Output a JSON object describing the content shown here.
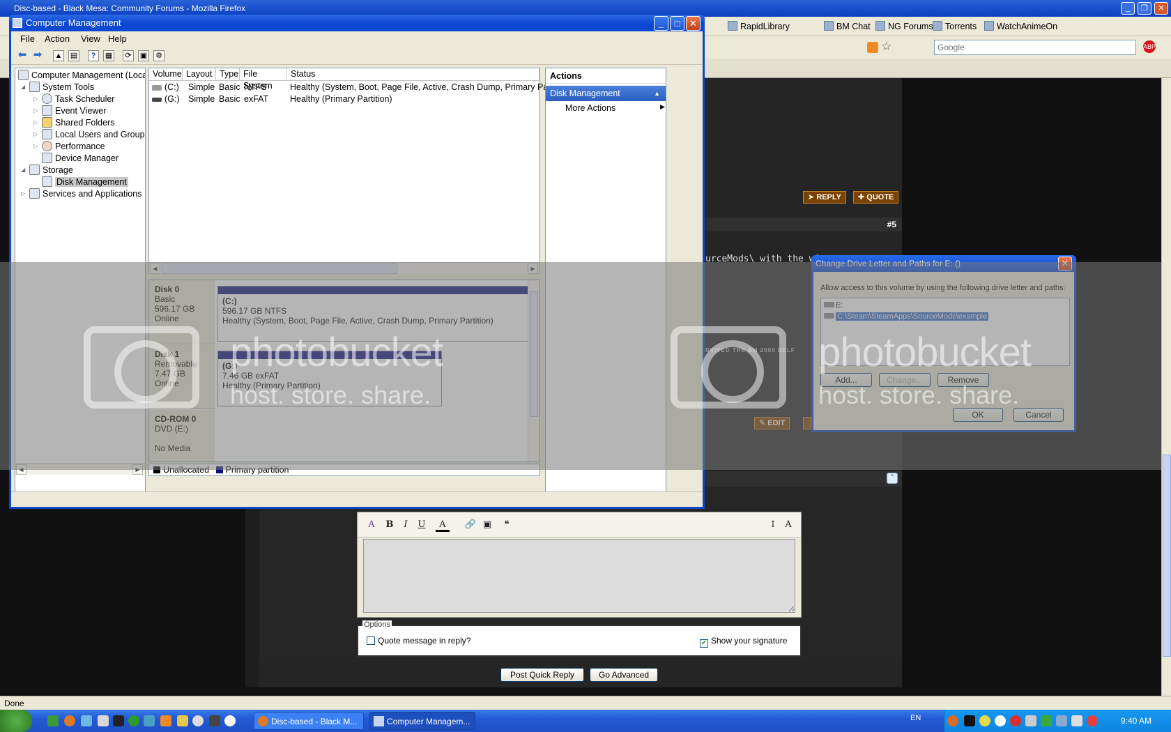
{
  "firefox": {
    "title": "Disc-based - Black Mesa: Community Forums - Mozilla Firefox",
    "bookmarks": [
      "RapidLibrary",
      "BM Chat",
      "NG Forums",
      "Torrents",
      "WatchAnimeOn"
    ],
    "search_placeholder": "Google",
    "status": "Done"
  },
  "forum": {
    "reply_label": "REPLY",
    "quote_label": "QUOTE",
    "post_number": "#5",
    "post_text_fragment": "urceMods\\ with the wi",
    "edit_label": "EDIT",
    "option_quote": "Quote message in reply?",
    "option_signature": "Show your signature",
    "options_legend": "Options",
    "post_quick_reply": "Post Quick Reply",
    "go_advanced": "Go Advanced",
    "banner_fragment": "RVIVED THE BM 2009 DELF"
  },
  "cm": {
    "title": "Computer Management",
    "menu": [
      "File",
      "Action",
      "View",
      "Help"
    ],
    "tree": {
      "root": "Computer Management (Local",
      "system_tools": "System Tools",
      "task_scheduler": "Task Scheduler",
      "event_viewer": "Event Viewer",
      "shared_folders": "Shared Folders",
      "local_users": "Local Users and Groups",
      "performance": "Performance",
      "device_manager": "Device Manager",
      "storage": "Storage",
      "disk_management": "Disk Management",
      "services": "Services and Applications"
    },
    "columns": [
      "Volume",
      "Layout",
      "Type",
      "File System",
      "Status"
    ],
    "volumes": [
      {
        "volume": "(C:)",
        "layout": "Simple",
        "type": "Basic",
        "fs": "NTFS",
        "status": "Healthy (System, Boot, Page File, Active, Crash Dump, Primary Partition)"
      },
      {
        "volume": "(G:)",
        "layout": "Simple",
        "type": "Basic",
        "fs": "exFAT",
        "status": "Healthy (Primary Partition)"
      }
    ],
    "disks": [
      {
        "name": "Disk 0",
        "kind": "Basic",
        "size": "596.17 GB",
        "state": "Online",
        "part_label": "(C:)",
        "part_size": "596.17 GB NTFS",
        "part_status": "Healthy (System, Boot, Page File, Active, Crash Dump, Primary Partition)"
      },
      {
        "name": "Disk 1",
        "kind": "Removable",
        "size": "7.47 GB",
        "state": "Online",
        "part_label": "(G:)",
        "part_size": "7.46 GB exFAT",
        "part_status": "Healthy (Primary Partition)"
      },
      {
        "name": "CD-ROM 0",
        "kind": "DVD (E:)",
        "size": "",
        "state": "No Media"
      }
    ],
    "legend": {
      "unallocated": "Unallocated",
      "primary": "Primary partition",
      "unallocated_color": "#000000",
      "primary_color": "#0a0f7a"
    },
    "actions": {
      "header": "Actions",
      "section": "Disk Management",
      "more": "More Actions"
    }
  },
  "dialog": {
    "title": "Change Drive Letter and Paths for E: ()",
    "message": "Allow access to this volume by using the following drive letter and paths:",
    "items": [
      "E:",
      "C:\\Steam\\SteamApps\\SourceMods\\example"
    ],
    "add": "Add...",
    "change": "Change...",
    "remove": "Remove",
    "ok": "OK",
    "cancel": "Cancel"
  },
  "watermark": {
    "logo": "photobucket",
    "tagline": "host. store. share."
  },
  "taskbar": {
    "tasks": [
      "Disc-based - Black M...",
      "Computer Managem..."
    ],
    "language": "EN",
    "clock": "9:40 AM"
  }
}
